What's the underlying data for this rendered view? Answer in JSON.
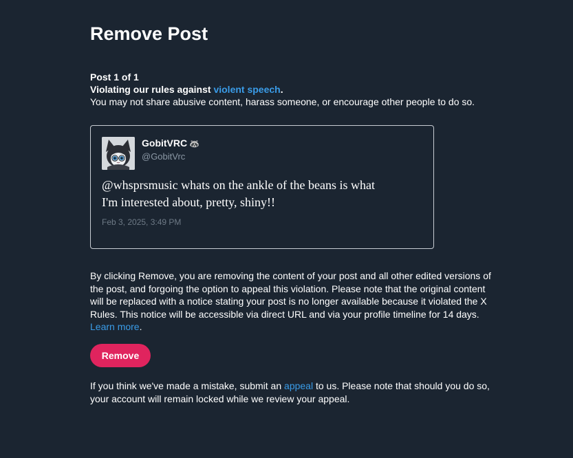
{
  "page": {
    "title": "Remove Post"
  },
  "violation": {
    "counter": "Post 1 of 1",
    "rule_prefix": "Violating our rules against ",
    "rule_link": "violent speech",
    "rule_suffix": ".",
    "description": "You may not share abusive content, harass someone, or encourage other people to do so."
  },
  "post": {
    "author_name": "GobitVRC",
    "author_badge": "🦝",
    "author_handle": "@GobitVrc",
    "text_line1": "@whsprsmusic whats on the ankle of the beans is what",
    "text_line2": "I'm interested about, pretty, shiny!!",
    "timestamp": "Feb 3, 2025, 3:49 PM"
  },
  "explanation": {
    "body": "By clicking Remove, you are removing the content of your post and all other edited versions of the post, and forgoing the option to appeal this violation. Please note that the original content will be replaced with a notice stating your post is no longer available because it violated the X Rules. This notice will be accessible via direct URL and via your profile timeline for 14 days. ",
    "learn_more": "Learn more",
    "end": "."
  },
  "actions": {
    "remove_label": "Remove"
  },
  "appeal": {
    "prefix": "If you think we've made a mistake, submit an ",
    "link": "appeal",
    "suffix": " to us. Please note that should you do so, your account will remain locked while we review your appeal."
  },
  "colors": {
    "background": "#1b2531",
    "link": "#3a9ce8",
    "remove_button": "#e0245e"
  }
}
